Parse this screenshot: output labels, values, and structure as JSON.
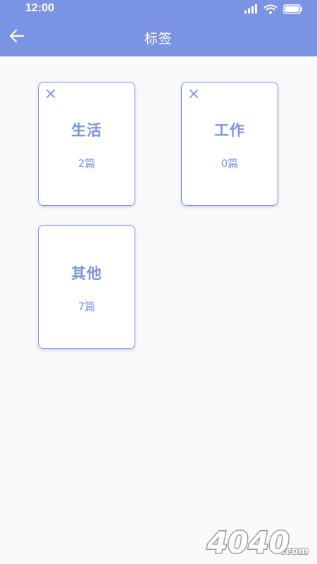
{
  "status": {
    "time": "12:00",
    "signal_icon": "signal-icon",
    "wifi_icon": "wifi-icon",
    "battery_icon": "battery-icon"
  },
  "header": {
    "title": "标签",
    "back_icon": "arrow-left-icon",
    "color": "#7b93e3"
  },
  "tags": [
    {
      "name": "生活",
      "count": "2篇",
      "deletable": true
    },
    {
      "name": "工作",
      "count": "0篇",
      "deletable": true
    },
    {
      "name": "其他",
      "count": "7篇",
      "deletable": false
    }
  ],
  "watermark": {
    "text": "4040.com"
  }
}
